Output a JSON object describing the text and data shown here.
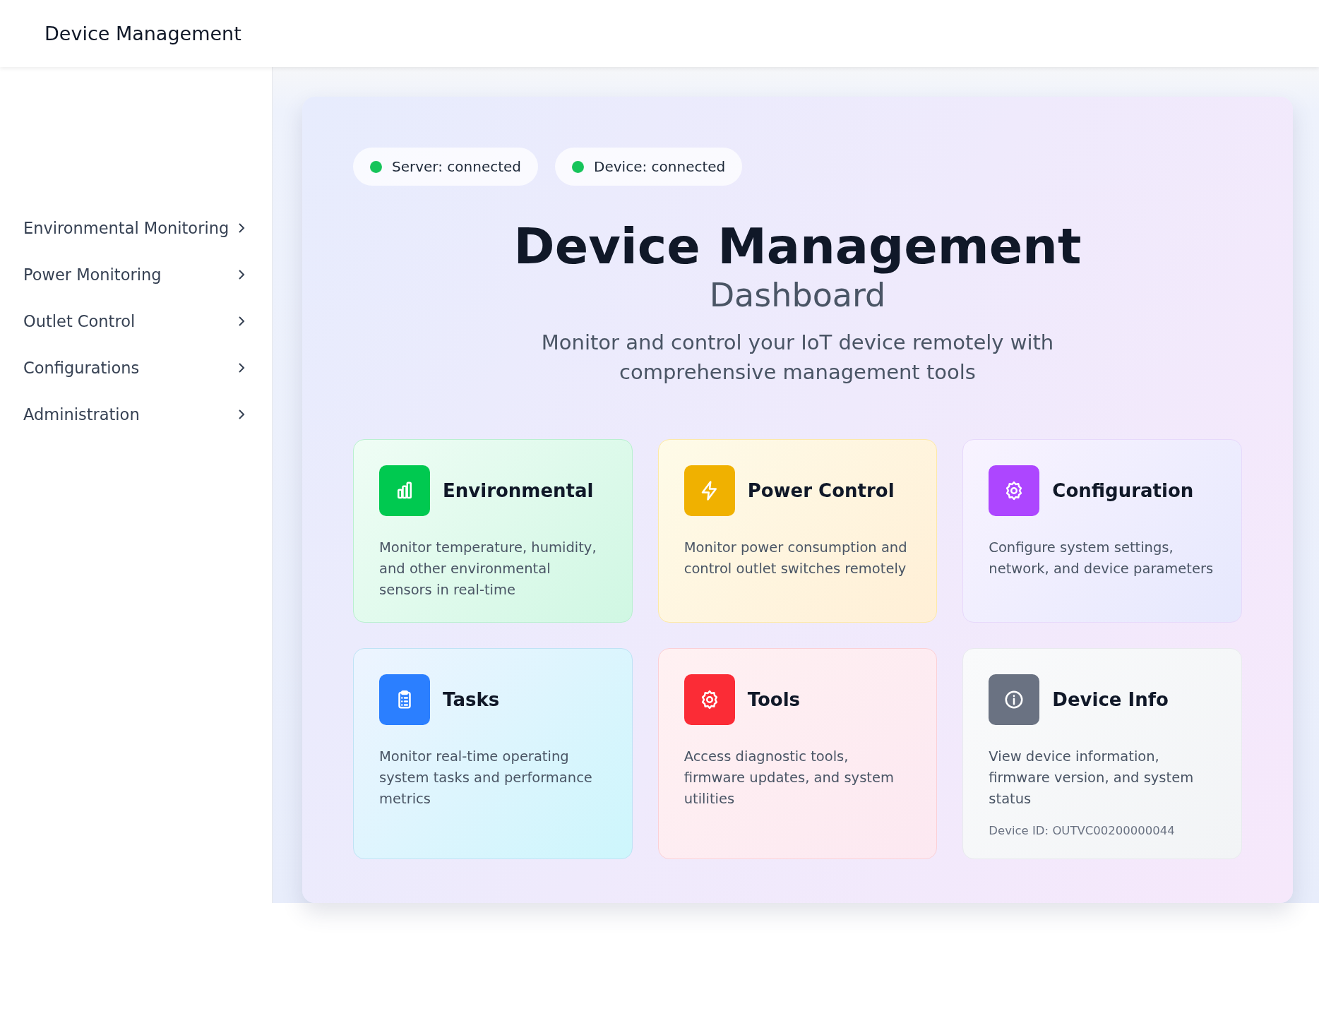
{
  "header": {
    "title": "Device Management"
  },
  "sidebar": {
    "items": [
      {
        "label": "Environmental Monitoring"
      },
      {
        "label": "Power Monitoring"
      },
      {
        "label": "Outlet Control"
      },
      {
        "label": "Configurations"
      },
      {
        "label": "Administration"
      }
    ]
  },
  "status": [
    {
      "label": "Server: connected",
      "color": "#16c45a"
    },
    {
      "label": "Device: connected",
      "color": "#16c45a"
    }
  ],
  "hero": {
    "title": "Device Management",
    "subtitle": "Dashboard",
    "description": "Monitor and control your IoT device remotely with comprehensive management tools"
  },
  "cards": [
    {
      "title": "Environmental",
      "description": "Monitor temperature, humidity, and other environmental sensors in real-time",
      "color": "#00c950"
    },
    {
      "title": "Power Control",
      "description": "Monitor power consumption and control outlet switches remotely",
      "color": "#f0b100"
    },
    {
      "title": "Configuration",
      "description": "Configure system settings, network, and device parameters",
      "color": "#ad46ff"
    },
    {
      "title": "Tasks",
      "description": "Monitor real-time operating system tasks and performance metrics",
      "color": "#2b7fff"
    },
    {
      "title": "Tools",
      "description": "Access diagnostic tools, firmware updates, and system utilities",
      "color": "#fb2c36"
    },
    {
      "title": "Device Info",
      "description": "View device information, firmware version, and system status",
      "color": "#6a7282",
      "device_id": "Device ID: OUTVC00200000044"
    }
  ]
}
